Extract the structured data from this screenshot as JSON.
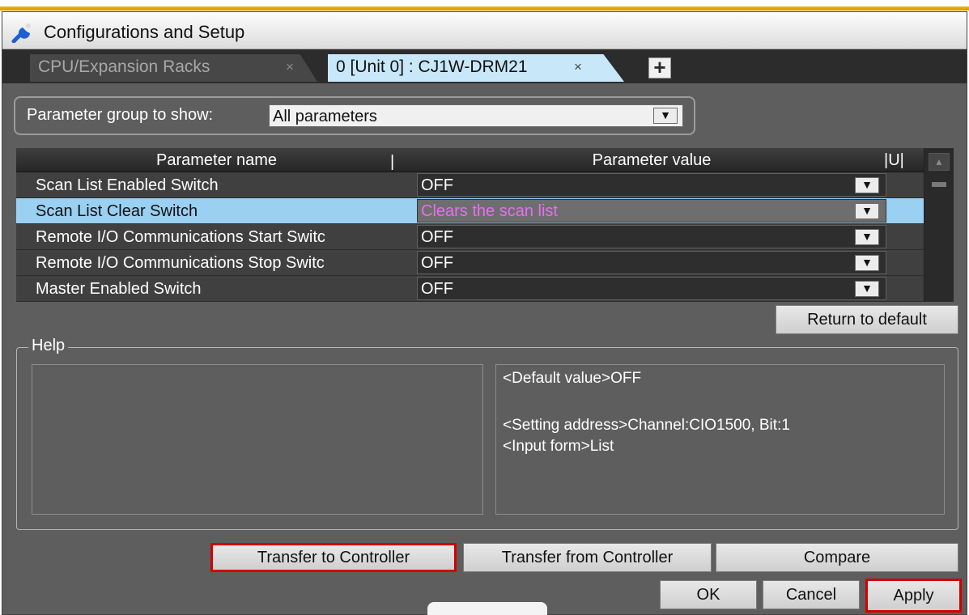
{
  "window": {
    "title": "Configurations and Setup"
  },
  "tabs": [
    {
      "label": "CPU/Expansion Racks",
      "active": false
    },
    {
      "label": "0 [Unit 0] : CJ1W-DRM21",
      "active": true
    }
  ],
  "tab_close_glyph": "×",
  "add_tab_glyph": "+",
  "parameter_group": {
    "label": "Parameter group to show:",
    "value": "All parameters"
  },
  "dropdown_glyph": "▼",
  "grid": {
    "columns": [
      "Parameter name",
      "Parameter value",
      "|U|"
    ],
    "rows": [
      {
        "name": "Scan List Enabled Switch",
        "value": "OFF",
        "selected": false
      },
      {
        "name": "Scan List Clear Switch",
        "value": "Clears the scan list",
        "selected": true
      },
      {
        "name": "Remote I/O Communications Start Switc",
        "value": "OFF",
        "selected": false
      },
      {
        "name": "Remote I/O Communications Stop Switc",
        "value": "OFF",
        "selected": false
      },
      {
        "name": "Master Enabled Switch",
        "value": "OFF",
        "selected": false
      }
    ]
  },
  "buttons": {
    "return_default": "Return to default",
    "transfer_to": "Transfer to Controller",
    "transfer_from": "Transfer from Controller",
    "compare": "Compare",
    "ok": "OK",
    "cancel": "Cancel",
    "apply": "Apply"
  },
  "help": {
    "legend": "Help",
    "default_value": "<Default value>OFF",
    "setting_address": "<Setting address>Channel:CIO1500, Bit:1",
    "input_form": "<Input form>List"
  },
  "colors": {
    "accent_highlight": "#d40000",
    "selected_row": "#9ad0f2",
    "active_tab": "#c8e8fa",
    "title_accent": "#f0b400"
  }
}
